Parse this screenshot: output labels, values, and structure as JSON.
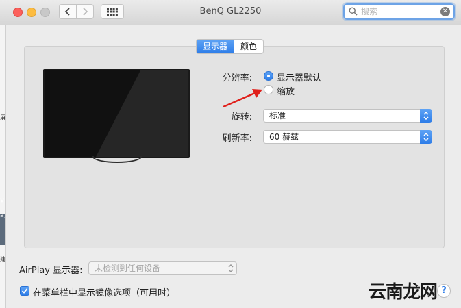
{
  "window": {
    "title": "BenQ GL2250"
  },
  "search": {
    "placeholder": "搜索",
    "value": ""
  },
  "tabs": [
    {
      "label": "显示器",
      "active": true
    },
    {
      "label": "颜色",
      "active": false
    }
  ],
  "resolution": {
    "label": "分辨率:",
    "options": [
      {
        "label": "显示器默认",
        "selected": true
      },
      {
        "label": "缩放",
        "selected": false
      }
    ]
  },
  "rotation": {
    "label": "旋转:",
    "value": "标准"
  },
  "refresh": {
    "label": "刷新率:",
    "value": "60 赫兹"
  },
  "airplay": {
    "label": "AirPlay 显示器:",
    "value": "未检测到任何设备"
  },
  "mirror_option": {
    "label": "在菜单栏中显示镜像选项（可用时）",
    "checked": true
  },
  "help": {
    "label": "?"
  },
  "watermark": {
    "text": "云南龙网"
  },
  "left_strip": {
    "text_1": "屏",
    "text_2": "X1",
    "text_3": "a]",
    "text_4": "建"
  },
  "colors": {
    "accent": "#2e7de8",
    "arrow": "#e0201b"
  }
}
